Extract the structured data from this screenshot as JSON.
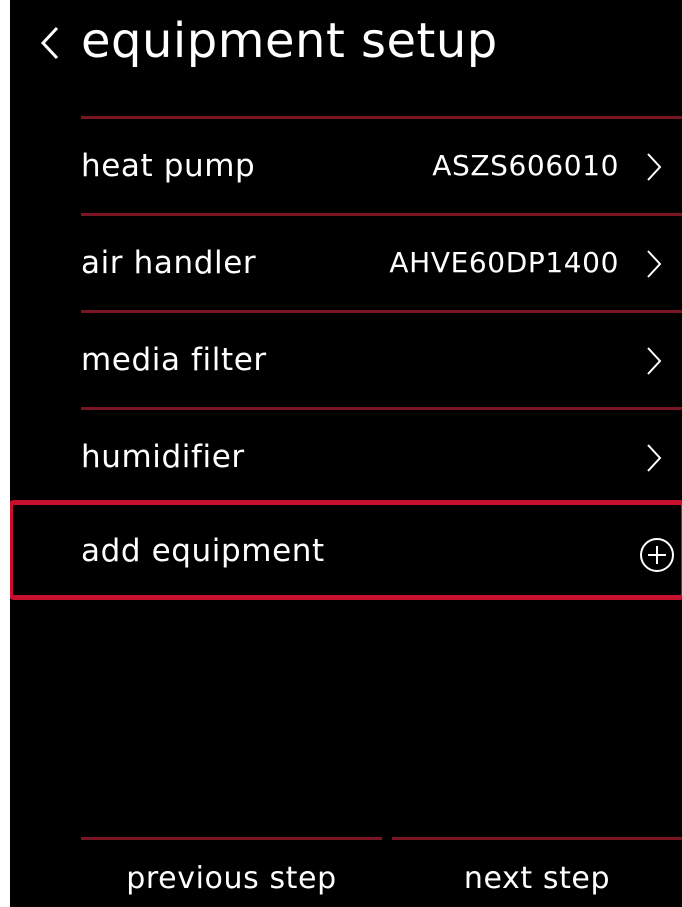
{
  "header": {
    "title": "equipment setup",
    "back_icon": "chevron-left-icon"
  },
  "equipment": {
    "items": [
      {
        "label": "heat pump",
        "value": "ASZS606010",
        "icon": "chevron-right-icon"
      },
      {
        "label": "air handler",
        "value": "AHVE60DP1400",
        "icon": "chevron-right-icon"
      },
      {
        "label": "media filter",
        "value": "",
        "icon": "chevron-right-icon"
      },
      {
        "label": "humidifier",
        "value": "",
        "icon": "chevron-right-icon"
      }
    ],
    "add": {
      "label": "add equipment",
      "icon": "plus-circle-icon"
    }
  },
  "footer": {
    "previous_label": "previous step",
    "next_label": "next step"
  },
  "colors": {
    "background": "#000000",
    "text": "#ffffff",
    "divider": "#7a1624",
    "highlight": "#c8102e"
  }
}
